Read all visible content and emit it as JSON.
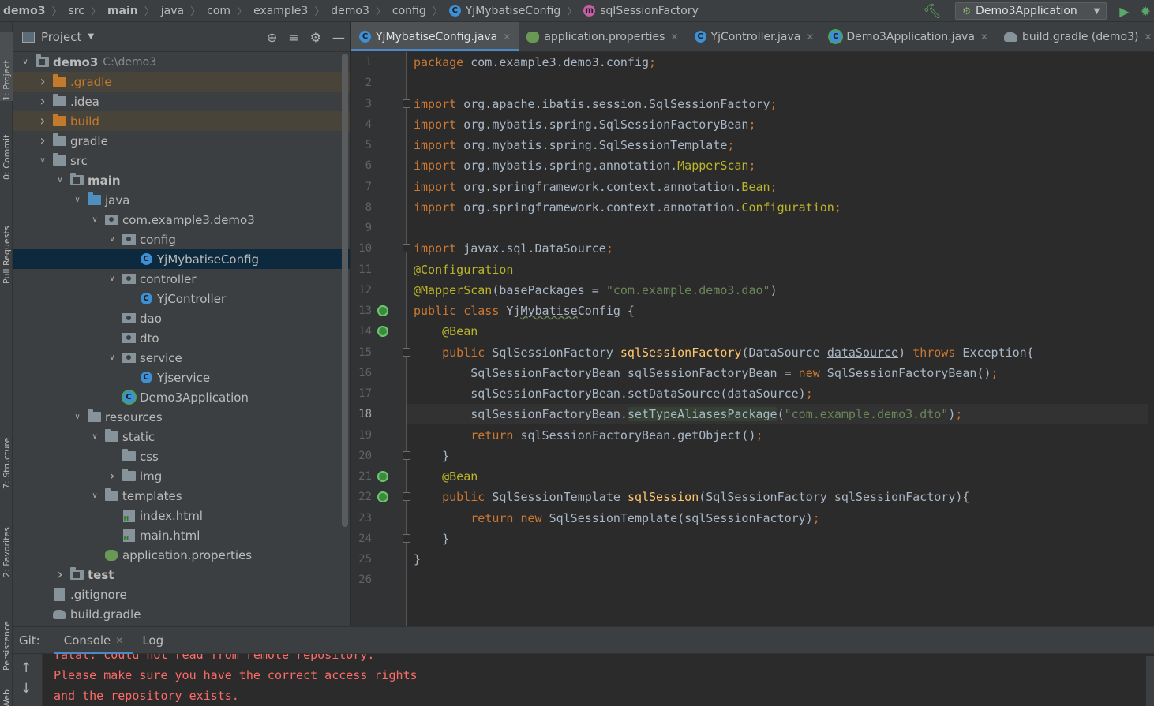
{
  "breadcrumbs": [
    {
      "label": "demo3",
      "bold": true,
      "icon": ""
    },
    {
      "label": "src",
      "bold": false,
      "icon": ""
    },
    {
      "label": "main",
      "bold": true,
      "icon": ""
    },
    {
      "label": "java",
      "bold": false,
      "icon": ""
    },
    {
      "label": "com",
      "bold": false,
      "icon": ""
    },
    {
      "label": "example3",
      "bold": false,
      "icon": ""
    },
    {
      "label": "demo3",
      "bold": false,
      "icon": ""
    },
    {
      "label": "config",
      "bold": false,
      "icon": ""
    },
    {
      "label": "YjMybatiseConfig",
      "bold": false,
      "icon": "class-icon"
    },
    {
      "label": "sqlSessionFactory",
      "bold": false,
      "icon": "method-icon"
    }
  ],
  "toolbar": {
    "run_config": "Demo3Application"
  },
  "left_stripe": {
    "project": "1: Project",
    "commit": "0: Commit",
    "pull_requests": "Pull Requests",
    "structure": "7: Structure",
    "favorites": "2: Favorites",
    "persistence": "Persistence",
    "web": "Web"
  },
  "project_panel": {
    "title": "Project",
    "root_path": "C:\\demo3"
  },
  "tree": [
    {
      "label": "demo3",
      "depth": 0,
      "arrow": "down",
      "icon": "module-folder",
      "style": "bold",
      "extra": "C:\\demo3"
    },
    {
      "label": ".gradle",
      "depth": 1,
      "arrow": "right",
      "icon": "folder-orange",
      "style": "orange",
      "excluded": true
    },
    {
      "label": ".idea",
      "depth": 1,
      "arrow": "right",
      "icon": "folder",
      "style": ""
    },
    {
      "label": "build",
      "depth": 1,
      "arrow": "right",
      "icon": "folder-orange",
      "style": "orange",
      "excluded": true
    },
    {
      "label": "gradle",
      "depth": 1,
      "arrow": "right",
      "icon": "folder",
      "style": ""
    },
    {
      "label": "src",
      "depth": 1,
      "arrow": "down",
      "icon": "folder",
      "style": ""
    },
    {
      "label": "main",
      "depth": 2,
      "arrow": "down",
      "icon": "folder-src",
      "style": "bold"
    },
    {
      "label": "java",
      "depth": 3,
      "arrow": "down",
      "icon": "folder-blue",
      "style": ""
    },
    {
      "label": "com.example3.demo3",
      "depth": 4,
      "arrow": "down",
      "icon": "package",
      "style": ""
    },
    {
      "label": "config",
      "depth": 5,
      "arrow": "down",
      "icon": "package",
      "style": ""
    },
    {
      "label": "YjMybatiseConfig",
      "depth": 6,
      "arrow": "",
      "icon": "class",
      "style": "",
      "selected": true
    },
    {
      "label": "controller",
      "depth": 5,
      "arrow": "down",
      "icon": "package",
      "style": ""
    },
    {
      "label": "YjController",
      "depth": 6,
      "arrow": "",
      "icon": "class",
      "style": ""
    },
    {
      "label": "dao",
      "depth": 5,
      "arrow": "",
      "icon": "package",
      "style": ""
    },
    {
      "label": "dto",
      "depth": 5,
      "arrow": "",
      "icon": "package",
      "style": ""
    },
    {
      "label": "service",
      "depth": 5,
      "arrow": "down",
      "icon": "package",
      "style": ""
    },
    {
      "label": "Yjservice",
      "depth": 6,
      "arrow": "",
      "icon": "class",
      "style": ""
    },
    {
      "label": "Demo3Application",
      "depth": 5,
      "arrow": "",
      "icon": "class-boot",
      "style": ""
    },
    {
      "label": "resources",
      "depth": 3,
      "arrow": "down",
      "icon": "folder-res",
      "style": ""
    },
    {
      "label": "static",
      "depth": 4,
      "arrow": "down",
      "icon": "folder",
      "style": ""
    },
    {
      "label": "css",
      "depth": 5,
      "arrow": "",
      "icon": "folder",
      "style": ""
    },
    {
      "label": "img",
      "depth": 5,
      "arrow": "right",
      "icon": "folder",
      "style": ""
    },
    {
      "label": "templates",
      "depth": 4,
      "arrow": "down",
      "icon": "folder",
      "style": ""
    },
    {
      "label": "index.html",
      "depth": 5,
      "arrow": "",
      "icon": "html",
      "style": ""
    },
    {
      "label": "main.html",
      "depth": 5,
      "arrow": "",
      "icon": "html",
      "style": ""
    },
    {
      "label": "application.properties",
      "depth": 4,
      "arrow": "",
      "icon": "properties",
      "style": ""
    },
    {
      "label": "test",
      "depth": 2,
      "arrow": "right",
      "icon": "folder-src",
      "style": "bold"
    },
    {
      "label": ".gitignore",
      "depth": 1,
      "arrow": "",
      "icon": "gitignore",
      "style": ""
    },
    {
      "label": "build.gradle",
      "depth": 1,
      "arrow": "",
      "icon": "gradle",
      "style": ""
    }
  ],
  "editor_tabs": [
    {
      "label": "YjMybatiseConfig.java",
      "icon": "class",
      "active": true
    },
    {
      "label": "application.properties",
      "icon": "properties",
      "active": false
    },
    {
      "label": "YjController.java",
      "icon": "class",
      "active": false
    },
    {
      "label": "Demo3Application.java",
      "icon": "class-boot",
      "active": false
    },
    {
      "label": "build.gradle (demo3)",
      "icon": "gradle",
      "active": false
    }
  ],
  "editor": {
    "current_line": 18,
    "gutter_icons": [
      13,
      14,
      21,
      22
    ],
    "fold_markers": [
      3,
      10,
      15,
      20,
      22,
      24
    ],
    "lines": [
      [
        [
          "kw",
          "package "
        ],
        [
          "",
          "com.example3.demo3.config"
        ],
        [
          "kw",
          ";"
        ]
      ],
      [],
      [
        [
          "kw",
          "import "
        ],
        [
          "",
          "org.apache.ibatis.session.SqlSessionFactory"
        ],
        [
          "kw",
          ";"
        ]
      ],
      [
        [
          "kw",
          "import "
        ],
        [
          "",
          "org.mybatis.spring.SqlSessionFactoryBean"
        ],
        [
          "kw",
          ";"
        ]
      ],
      [
        [
          "kw",
          "import "
        ],
        [
          "",
          "org.mybatis.spring.SqlSessionTemplate"
        ],
        [
          "kw",
          ";"
        ]
      ],
      [
        [
          "kw",
          "import "
        ],
        [
          "",
          "org.mybatis.spring.annotation."
        ],
        [
          "ann",
          "MapperScan"
        ],
        [
          "kw",
          ";"
        ]
      ],
      [
        [
          "kw",
          "import "
        ],
        [
          "",
          "org.springframework.context.annotation."
        ],
        [
          "ann",
          "Bean"
        ],
        [
          "kw",
          ";"
        ]
      ],
      [
        [
          "kw",
          "import "
        ],
        [
          "",
          "org.springframework.context.annotation."
        ],
        [
          "ann",
          "Configuration"
        ],
        [
          "kw",
          ";"
        ]
      ],
      [],
      [
        [
          "kw",
          "import "
        ],
        [
          "",
          "javax.sql.DataSource"
        ],
        [
          "kw",
          ";"
        ]
      ],
      [
        [
          "ann",
          "@Configuration"
        ]
      ],
      [
        [
          "ann",
          "@MapperScan"
        ],
        [
          "",
          "(basePackages = "
        ],
        [
          "str",
          "\"com.example.demo3.dao\""
        ],
        [
          "",
          ")"
        ]
      ],
      [
        [
          "kw",
          "public class "
        ],
        [
          "",
          "Yj"
        ],
        [
          "squig",
          "Mybatise"
        ],
        [
          "",
          "Config {"
        ]
      ],
      [
        [
          "",
          "    "
        ],
        [
          "ann",
          "@Bean"
        ]
      ],
      [
        [
          "",
          "    "
        ],
        [
          "kw",
          "public "
        ],
        [
          "",
          "SqlSessionFactory "
        ],
        [
          "fn",
          "sqlSessionFactory"
        ],
        [
          "",
          "(DataSource "
        ],
        [
          "pm",
          "dataSource"
        ],
        [
          "",
          ") "
        ],
        [
          "kw",
          "throws "
        ],
        [
          "",
          "Exception{"
        ]
      ],
      [
        [
          "",
          "        SqlSessionFactoryBean sqlSessionFactoryBean = "
        ],
        [
          "kw",
          "new "
        ],
        [
          "",
          "SqlSessionFactoryBean()"
        ],
        [
          "kw",
          ";"
        ]
      ],
      [
        [
          "",
          "        sqlSessionFactoryBean.setDataSource(dataSource)"
        ],
        [
          "kw",
          ";"
        ]
      ],
      [
        [
          "",
          "        sqlSessionFactoryBean."
        ],
        [
          "hl",
          "setTypeAliasesPackage"
        ],
        [
          "",
          "("
        ],
        [
          "str",
          "\"com.example.demo3.dto\""
        ],
        [
          "",
          ")"
        ],
        [
          "kw",
          ";"
        ]
      ],
      [
        [
          "",
          "        "
        ],
        [
          "kw",
          "return "
        ],
        [
          "",
          "sqlSessionFactoryBean.getObject()"
        ],
        [
          "kw",
          ";"
        ]
      ],
      [
        [
          "",
          "    }"
        ]
      ],
      [
        [
          "",
          "    "
        ],
        [
          "ann",
          "@Bean"
        ]
      ],
      [
        [
          "",
          "    "
        ],
        [
          "kw",
          "public "
        ],
        [
          "",
          "SqlSessionTemplate "
        ],
        [
          "fn",
          "sqlSession"
        ],
        [
          "",
          "(SqlSessionFactory sqlSessionFactory){"
        ]
      ],
      [
        [
          "",
          "        "
        ],
        [
          "kw",
          "return new "
        ],
        [
          "",
          "SqlSessionTemplate(sqlSessionFactory)"
        ],
        [
          "kw",
          ";"
        ]
      ],
      [
        [
          "",
          "    }"
        ]
      ],
      [
        [
          "",
          "}"
        ]
      ],
      []
    ]
  },
  "bottom_panel": {
    "git_label": "Git:",
    "tabs": [
      {
        "label": "Console",
        "active": true,
        "closable": true
      },
      {
        "label": "Log",
        "active": false,
        "closable": false
      }
    ],
    "console_lines": [
      "fatal: could not read from remote repository.",
      "Please make sure you have the correct access rights",
      "and the repository exists."
    ]
  },
  "colors": {
    "keyword": "#cc7832",
    "annotation": "#bbb529",
    "string": "#6a8759",
    "method": "#ffc66d",
    "error": "#ff6b68",
    "accent": "#4a88c7"
  }
}
